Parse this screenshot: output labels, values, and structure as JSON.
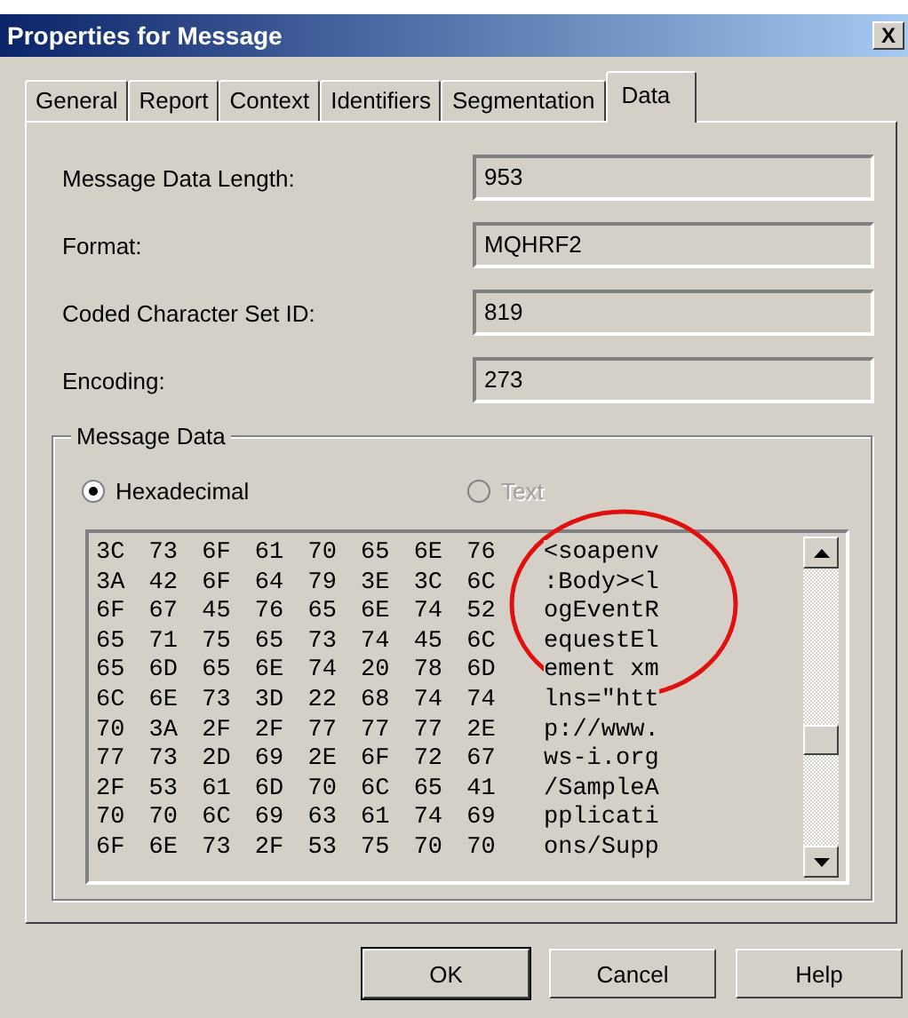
{
  "window": {
    "title": "Properties for Message",
    "close": "X"
  },
  "tabs": [
    {
      "label": "General",
      "selected": false
    },
    {
      "label": "Report",
      "selected": false
    },
    {
      "label": "Context",
      "selected": false
    },
    {
      "label": "Identifiers",
      "selected": false
    },
    {
      "label": "Segmentation",
      "selected": false
    },
    {
      "label": "Data",
      "selected": true
    }
  ],
  "fields": [
    {
      "label": "Message Data Length:",
      "value": "953"
    },
    {
      "label": "Format:",
      "value": "MQHRF2"
    },
    {
      "label": "Coded Character Set ID:",
      "value": "819"
    },
    {
      "label": "Encoding:",
      "value": "273"
    }
  ],
  "message_data": {
    "title": "Message Data",
    "options": [
      {
        "label": "Hexadecimal",
        "selected": true,
        "disabled": false
      },
      {
        "label": "Text",
        "selected": false,
        "disabled": true
      }
    ],
    "rows": [
      {
        "hex": "3C 73 6F 61 70 65 6E 76",
        "text": "<soapenv"
      },
      {
        "hex": "3A 42 6F 64 79 3E 3C 6C",
        "text": ":Body><l"
      },
      {
        "hex": "6F 67 45 76 65 6E 74 52",
        "text": "ogEventR"
      },
      {
        "hex": "65 71 75 65 73 74 45 6C",
        "text": "equestEl"
      },
      {
        "hex": "65 6D 65 6E 74 20 78 6D",
        "text": "ement xm"
      },
      {
        "hex": "6C 6E 73 3D 22 68 74 74",
        "text": "lns=\"htt"
      },
      {
        "hex": "70 3A 2F 2F 77 77 77 2E",
        "text": "p://www."
      },
      {
        "hex": "77 73 2D 69 2E 6F 72 67",
        "text": "ws-i.org"
      },
      {
        "hex": "2F 53 61 6D 70 6C 65 41",
        "text": "/SampleA"
      },
      {
        "hex": "70 70 6C 69 63 61 74 69",
        "text": "pplicati"
      },
      {
        "hex": "6F 6E 73 2F 53 75 70 70",
        "text": "ons/Supp"
      }
    ]
  },
  "buttons": [
    {
      "label": "OK",
      "default": true
    },
    {
      "label": "Cancel",
      "default": false
    },
    {
      "label": "Help",
      "default": false
    }
  ]
}
